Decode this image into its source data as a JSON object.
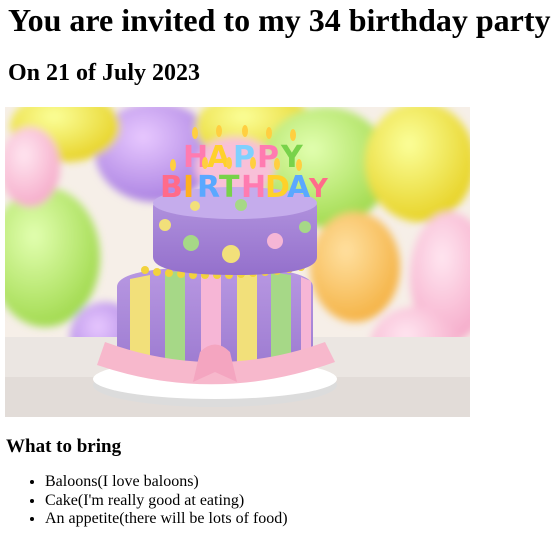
{
  "page": {
    "title": "You are invited to my 34 birthday party",
    "date": "On 21 of July 2023",
    "image": {
      "name": "birthday-cake-photo",
      "topper_text": "HAPPY BIRTHDAY"
    },
    "bring": {
      "heading": "What to bring",
      "items": [
        "Baloons(I love baloons)",
        "Cake(I'm really good at eating)",
        "An appetite(there will be lots of food)"
      ]
    }
  }
}
